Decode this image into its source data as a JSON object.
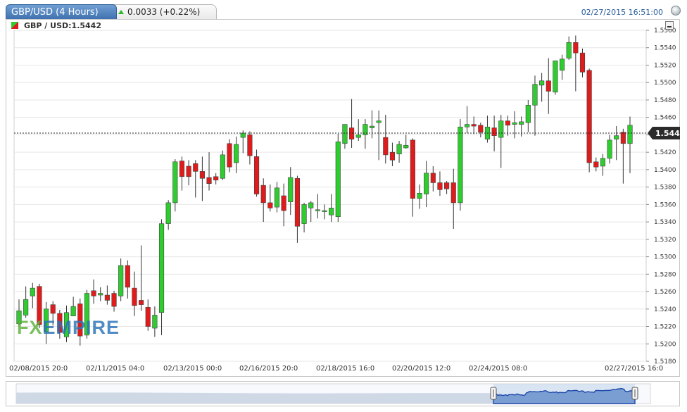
{
  "header": {
    "active_tab": "GBP/USD (4 Hours)",
    "change": "0.0033 (+0.22%)",
    "timestamp": "02/27/2015 16:51:00"
  },
  "legend": {
    "label": "GBP / USD:1.5442"
  },
  "logo": {
    "part1": "FX",
    "part2": "EMPIRE"
  },
  "colors": {
    "up": "#2ecc2e",
    "down": "#e01b1b",
    "accent": "#3d6fae"
  },
  "icons": {
    "settings": "gear-icon",
    "minimize": "minimize-icon",
    "change": "triangle-up-icon"
  },
  "chart_data": {
    "type": "candlestick",
    "ylim": [
      1.518,
      1.556
    ],
    "y_ticks": [
      "1.5180",
      "1.5200",
      "1.5220",
      "1.5240",
      "1.5260",
      "1.5280",
      "1.5300",
      "1.5320",
      "1.5340",
      "1.5360",
      "1.5380",
      "1.5400",
      "1.5420",
      "1.5440",
      "1.5460",
      "1.5480",
      "1.5500",
      "1.5520",
      "1.5540",
      "1.5560"
    ],
    "x_ticks": [
      "02/08/2015 20:0",
      "02/11/2015 04:0",
      "02/13/2015 00:0",
      "02/16/2015 20:0",
      "02/18/2015 16:0",
      "02/20/2015 12:0",
      "02/24/2015 08:0",
      "02/27/2015 16:0"
    ],
    "last_price": "1.5442",
    "last_value": 1.5442,
    "candles": [
      [
        1.5223,
        1.5251,
        1.5221,
        1.5238
      ],
      [
        1.5233,
        1.5266,
        1.523,
        1.5251
      ],
      [
        1.5255,
        1.527,
        1.5241,
        1.5264
      ],
      [
        1.5266,
        1.5269,
        1.5218,
        1.5222
      ],
      [
        1.5214,
        1.5248,
        1.52,
        1.524
      ],
      [
        1.5245,
        1.5249,
        1.5221,
        1.5235
      ],
      [
        1.5235,
        1.5239,
        1.5206,
        1.5213
      ],
      [
        1.5208,
        1.5244,
        1.5202,
        1.5236
      ],
      [
        1.5232,
        1.5254,
        1.5232,
        1.5243
      ],
      [
        1.5246,
        1.5252,
        1.5198,
        1.5209
      ],
      [
        1.521,
        1.5262,
        1.5206,
        1.5258
      ],
      [
        1.5261,
        1.5274,
        1.5246,
        1.5255
      ],
      [
        1.5256,
        1.5265,
        1.5249,
        1.5258
      ],
      [
        1.5256,
        1.5267,
        1.5245,
        1.525
      ],
      [
        1.5258,
        1.5261,
        1.5237,
        1.5243
      ],
      [
        1.5255,
        1.5298,
        1.5249,
        1.529
      ],
      [
        1.529,
        1.5296,
        1.5252,
        1.5265
      ],
      [
        1.5264,
        1.5283,
        1.5232,
        1.5244
      ],
      [
        1.525,
        1.5313,
        1.5238,
        1.5245
      ],
      [
        1.5242,
        1.5251,
        1.5215,
        1.522
      ],
      [
        1.5218,
        1.5243,
        1.5208,
        1.5233
      ],
      [
        1.5236,
        1.5343,
        1.521,
        1.5338
      ],
      [
        1.5338,
        1.5365,
        1.5331,
        1.5362
      ],
      [
        1.5362,
        1.5412,
        1.5352,
        1.5409
      ],
      [
        1.541,
        1.5415,
        1.5376,
        1.5392
      ],
      [
        1.5404,
        1.5411,
        1.5382,
        1.5392
      ],
      [
        1.5407,
        1.5411,
        1.5368,
        1.5398
      ],
      [
        1.5398,
        1.5415,
        1.5364,
        1.539
      ],
      [
        1.5391,
        1.542,
        1.5376,
        1.5384
      ],
      [
        1.5392,
        1.5396,
        1.5383,
        1.5388
      ],
      [
        1.539,
        1.5422,
        1.5388,
        1.5417
      ],
      [
        1.543,
        1.5435,
        1.5397,
        1.5403
      ],
      [
        1.5408,
        1.5438,
        1.5396,
        1.5429
      ],
      [
        1.5437,
        1.5445,
        1.5419,
        1.5442
      ],
      [
        1.544,
        1.5444,
        1.5406,
        1.5416
      ],
      [
        1.5415,
        1.5423,
        1.5369,
        1.5372
      ],
      [
        1.5382,
        1.539,
        1.534,
        1.5362
      ],
      [
        1.5362,
        1.5383,
        1.5352,
        1.5356
      ],
      [
        1.5357,
        1.5386,
        1.5351,
        1.5379
      ],
      [
        1.537,
        1.5384,
        1.5335,
        1.5353
      ],
      [
        1.5363,
        1.5403,
        1.5348,
        1.5391
      ],
      [
        1.539,
        1.5393,
        1.5316,
        1.5335
      ],
      [
        1.5338,
        1.5362,
        1.5328,
        1.536
      ],
      [
        1.5356,
        1.5364,
        1.534,
        1.5362
      ],
      [
        1.5354,
        1.5372,
        1.5344,
        1.5354
      ],
      [
        1.5353,
        1.536,
        1.5343,
        1.5353
      ],
      [
        1.5348,
        1.5372,
        1.534,
        1.5356
      ],
      [
        1.5346,
        1.5441,
        1.534,
        1.5432
      ],
      [
        1.543,
        1.545,
        1.5424,
        1.5452
      ],
      [
        1.5448,
        1.5481,
        1.5425,
        1.5435
      ],
      [
        1.5437,
        1.5458,
        1.5433,
        1.544
      ],
      [
        1.544,
        1.5458,
        1.5424,
        1.5452
      ],
      [
        1.5448,
        1.5468,
        1.5436,
        1.545
      ],
      [
        1.5454,
        1.5468,
        1.5411,
        1.5456
      ],
      [
        1.5437,
        1.5463,
        1.5407,
        1.5417
      ],
      [
        1.542,
        1.5431,
        1.5404,
        1.5411
      ],
      [
        1.5418,
        1.5433,
        1.5408,
        1.5429
      ],
      [
        1.5425,
        1.544,
        1.5424,
        1.5428
      ],
      [
        1.5434,
        1.5436,
        1.5346,
        1.5367
      ],
      [
        1.5367,
        1.5383,
        1.5355,
        1.5373
      ],
      [
        1.5372,
        1.541,
        1.5357,
        1.5396
      ],
      [
        1.5396,
        1.5404,
        1.5375,
        1.5385
      ],
      [
        1.5385,
        1.5398,
        1.537,
        1.5377
      ],
      [
        1.5385,
        1.5387,
        1.5372,
        1.5378
      ],
      [
        1.5385,
        1.5401,
        1.5332,
        1.5362
      ],
      [
        1.5362,
        1.5458,
        1.5353,
        1.5449
      ],
      [
        1.5449,
        1.5473,
        1.5442,
        1.5452
      ],
      [
        1.5452,
        1.5461,
        1.5441,
        1.545
      ],
      [
        1.5451,
        1.5454,
        1.5437,
        1.5443
      ],
      [
        1.5435,
        1.5462,
        1.5431,
        1.5449
      ],
      [
        1.5448,
        1.5462,
        1.5421,
        1.5439
      ],
      [
        1.5437,
        1.5463,
        1.5402,
        1.5456
      ],
      [
        1.5456,
        1.5462,
        1.5439,
        1.5451
      ],
      [
        1.5452,
        1.5467,
        1.5436,
        1.5454
      ],
      [
        1.5452,
        1.5461,
        1.5438,
        1.5455
      ],
      [
        1.5454,
        1.548,
        1.5443,
        1.5474
      ],
      [
        1.5474,
        1.5508,
        1.5439,
        1.5498
      ],
      [
        1.5497,
        1.5511,
        1.5478,
        1.5502
      ],
      [
        1.5502,
        1.5528,
        1.5464,
        1.549
      ],
      [
        1.5489,
        1.5525,
        1.5486,
        1.5525
      ],
      [
        1.5514,
        1.5532,
        1.5503,
        1.5527
      ],
      [
        1.5528,
        1.5553,
        1.5526,
        1.5546
      ],
      [
        1.5546,
        1.5554,
        1.549,
        1.5534
      ],
      [
        1.5534,
        1.5539,
        1.5506,
        1.5512
      ],
      [
        1.5514,
        1.5516,
        1.5397,
        1.5408
      ],
      [
        1.5409,
        1.5414,
        1.5398,
        1.5403
      ],
      [
        1.5404,
        1.5418,
        1.5393,
        1.5413
      ],
      [
        1.5413,
        1.544,
        1.5407,
        1.5434
      ],
      [
        1.5435,
        1.545,
        1.5411,
        1.5439
      ],
      [
        1.5443,
        1.5447,
        1.5384,
        1.543
      ],
      [
        1.543,
        1.5461,
        1.5396,
        1.5451
      ]
    ]
  }
}
